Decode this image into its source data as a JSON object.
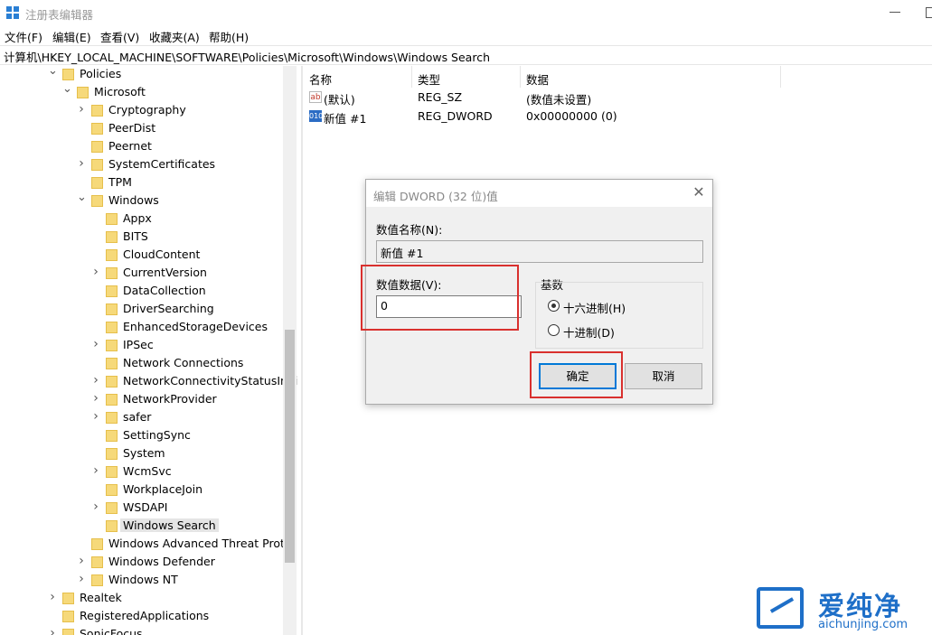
{
  "window": {
    "title": "注册表编辑器",
    "accent": "#2a7fd4"
  },
  "menu": [
    "文件(F)",
    "编辑(E)",
    "查看(V)",
    "收藏夹(A)",
    "帮助(H)"
  ],
  "address": "计算机\\HKEY_LOCAL_MACHINE\\SOFTWARE\\Policies\\Microsoft\\Windows\\Windows Search",
  "tree": [
    {
      "label": "Policies",
      "chevron": "v",
      "level": 0
    },
    {
      "label": "Microsoft",
      "chevron": "v",
      "level": 1
    },
    {
      "label": "Cryptography",
      "chevron": ">",
      "level": 2
    },
    {
      "label": "PeerDist",
      "chevron": "",
      "level": 2
    },
    {
      "label": "Peernet",
      "chevron": "",
      "level": 2
    },
    {
      "label": "SystemCertificates",
      "chevron": ">",
      "level": 2
    },
    {
      "label": "TPM",
      "chevron": "",
      "level": 2
    },
    {
      "label": "Windows",
      "chevron": "v",
      "level": 2
    },
    {
      "label": "Appx",
      "chevron": "",
      "level": 3
    },
    {
      "label": "BITS",
      "chevron": "",
      "level": 3
    },
    {
      "label": "CloudContent",
      "chevron": "",
      "level": 3
    },
    {
      "label": "CurrentVersion",
      "chevron": ">",
      "level": 3
    },
    {
      "label": "DataCollection",
      "chevron": "",
      "level": 3
    },
    {
      "label": "DriverSearching",
      "chevron": "",
      "level": 3
    },
    {
      "label": "EnhancedStorageDevices",
      "chevron": "",
      "level": 3
    },
    {
      "label": "IPSec",
      "chevron": ">",
      "level": 3
    },
    {
      "label": "Network Connections",
      "chevron": "",
      "level": 3
    },
    {
      "label": "NetworkConnectivityStatusIndi",
      "chevron": ">",
      "level": 3
    },
    {
      "label": "NetworkProvider",
      "chevron": ">",
      "level": 3
    },
    {
      "label": "safer",
      "chevron": ">",
      "level": 3
    },
    {
      "label": "SettingSync",
      "chevron": "",
      "level": 3
    },
    {
      "label": "System",
      "chevron": "",
      "level": 3
    },
    {
      "label": "WcmSvc",
      "chevron": ">",
      "level": 3
    },
    {
      "label": "WorkplaceJoin",
      "chevron": "",
      "level": 3
    },
    {
      "label": "WSDAPI",
      "chevron": ">",
      "level": 3
    },
    {
      "label": "Windows Search",
      "chevron": "",
      "level": 3,
      "selected": true
    },
    {
      "label": "Windows Advanced Threat Prote",
      "chevron": "",
      "level": 2
    },
    {
      "label": "Windows Defender",
      "chevron": ">",
      "level": 2
    },
    {
      "label": "Windows NT",
      "chevron": ">",
      "level": 2
    },
    {
      "label": "Realtek",
      "chevron": ">",
      "level": 0
    },
    {
      "label": "RegisteredApplications",
      "chevron": "",
      "level": 0
    },
    {
      "label": "SonicFocus",
      "chevron": ">",
      "level": 0
    }
  ],
  "columns": {
    "name": "名称",
    "type": "类型",
    "data": "数据"
  },
  "values": [
    {
      "icon": "string-value-icon",
      "icon_text": "ab",
      "name": "(默认)",
      "type": "REG_SZ",
      "data": "(数值未设置)"
    },
    {
      "icon": "binary-value-icon",
      "icon_text": "010",
      "name": "新值 #1",
      "type": "REG_DWORD",
      "data": "0x00000000 (0)"
    }
  ],
  "dialog": {
    "title": "编辑 DWORD (32 位)值",
    "name_label": "数值名称(N):",
    "name_value": "新值 #1",
    "data_label": "数值数据(V):",
    "data_value": "0",
    "base_label": "基数",
    "radio_hex": "十六进制(H)",
    "radio_dec": "十进制(D)",
    "selected_base": "hex",
    "ok": "确定",
    "cancel": "取消",
    "highlight_color": "#d9302e"
  },
  "watermark": {
    "cn": "爱纯净",
    "en": "aichunjing.com"
  }
}
